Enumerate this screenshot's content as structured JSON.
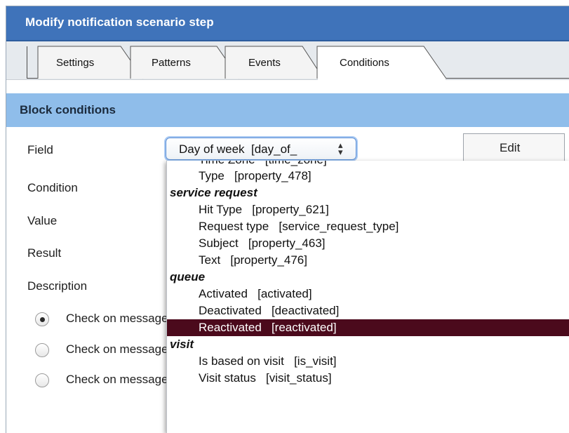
{
  "window": {
    "title": "Modify notification scenario step"
  },
  "tabs": [
    {
      "label": "Settings",
      "active": false
    },
    {
      "label": "Patterns",
      "active": false
    },
    {
      "label": "Events",
      "active": false
    },
    {
      "label": "Conditions",
      "active": true
    }
  ],
  "section": {
    "title": "Block conditions"
  },
  "form": {
    "field_label": "Field",
    "condition_label": "Condition",
    "value_label": "Value",
    "result_label": "Result",
    "description_label": "Description",
    "field_select_value": "Day of week  [day_of_",
    "edit_button": "Edit"
  },
  "radios": [
    {
      "label": "Check on message",
      "checked": true
    },
    {
      "label": "Check on message",
      "checked": false
    },
    {
      "label": "Check on message",
      "checked": false
    }
  ],
  "dropdown": {
    "clipped_item": "Time Zone   [time_zone]",
    "items": [
      {
        "label": "Type   [property_478]",
        "group": false,
        "selected": false
      },
      {
        "label": "service request",
        "group": true,
        "selected": false
      },
      {
        "label": "Hit Type   [property_621]",
        "group": false,
        "selected": false
      },
      {
        "label": "Request type   [service_request_type]",
        "group": false,
        "selected": false
      },
      {
        "label": "Subject   [property_463]",
        "group": false,
        "selected": false
      },
      {
        "label": "Text   [property_476]",
        "group": false,
        "selected": false
      },
      {
        "label": "queue",
        "group": true,
        "selected": false
      },
      {
        "label": "Activated   [activated]",
        "group": false,
        "selected": false
      },
      {
        "label": "Deactivated   [deactivated]",
        "group": false,
        "selected": false
      },
      {
        "label": "Reactivated   [reactivated]",
        "group": false,
        "selected": true
      },
      {
        "label": "visit",
        "group": true,
        "selected": false
      },
      {
        "label": "Is based on visit   [is_visit]",
        "group": false,
        "selected": false
      },
      {
        "label": "Visit status   [visit_status]",
        "group": false,
        "selected": false
      }
    ]
  },
  "colors": {
    "titlebar": "#3f73ba",
    "banner": "#8fbdea",
    "selected_item": "#4b0a1c"
  }
}
